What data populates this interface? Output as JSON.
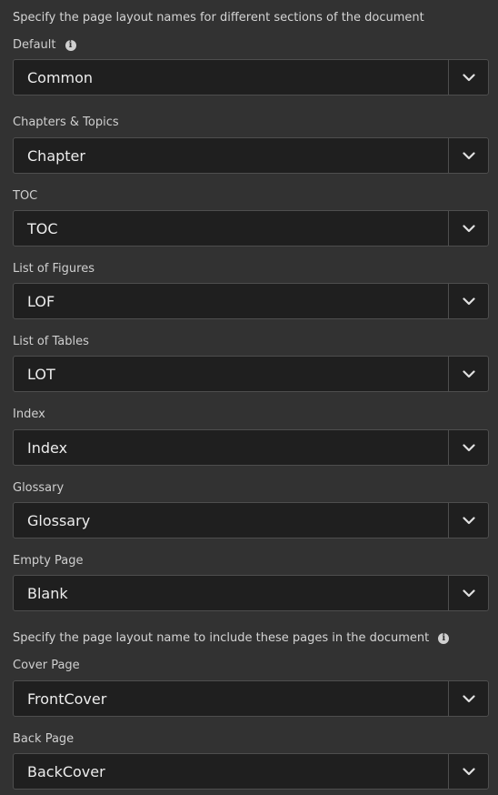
{
  "section1": {
    "heading": "Specify the page layout names for different sections of the document",
    "default_label": "Default"
  },
  "fields": [
    {
      "label": "Default",
      "value": "Common"
    },
    {
      "label": "Chapters & Topics",
      "value": "Chapter"
    },
    {
      "label": "TOC",
      "value": "TOC"
    },
    {
      "label": "List of Figures",
      "value": "LOF"
    },
    {
      "label": "List of Tables",
      "value": "LOT"
    },
    {
      "label": "Index",
      "value": "Index"
    },
    {
      "label": "Glossary",
      "value": "Glossary"
    },
    {
      "label": "Empty Page",
      "value": "Blank"
    },
    {
      "label": "Cover Page",
      "value": "FrontCover"
    },
    {
      "label": "Back Page",
      "value": "BackCover"
    }
  ],
  "section2": {
    "heading": "Specify the page layout name to include these pages in the document"
  },
  "icons": {
    "info": "info-icon",
    "dropdown": "chevron-down-icon"
  },
  "colors": {
    "background": "#323232",
    "field_background": "#1f1f1f",
    "field_border": "#4e4e4e",
    "text": "#ececec"
  }
}
